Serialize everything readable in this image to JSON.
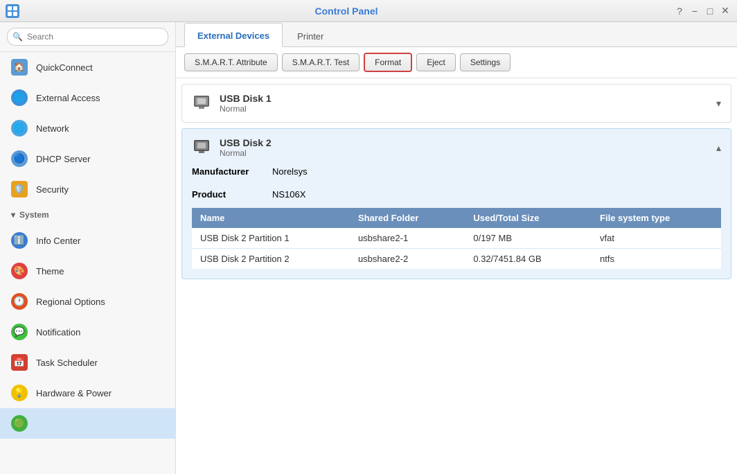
{
  "titlebar": {
    "title": "Control Panel",
    "icon_label": "CP",
    "controls": {
      "question": "?",
      "minimize": "−",
      "maximize": "□",
      "close": "✕"
    }
  },
  "sidebar": {
    "search_placeholder": "Search",
    "items": [
      {
        "id": "home",
        "label": "QuickConnect",
        "icon_type": "home"
      },
      {
        "id": "external-access",
        "label": "External Access",
        "icon_type": "external-access"
      },
      {
        "id": "network",
        "label": "Network",
        "icon_type": "network"
      },
      {
        "id": "dhcp",
        "label": "DHCP Server",
        "icon_type": "dhcp"
      },
      {
        "id": "security",
        "label": "Security",
        "icon_type": "security"
      },
      {
        "id": "system-header",
        "label": "System",
        "is_header": true
      },
      {
        "id": "infocenter",
        "label": "Info Center",
        "icon_type": "infocenter"
      },
      {
        "id": "theme",
        "label": "Theme",
        "icon_type": "theme"
      },
      {
        "id": "regional",
        "label": "Regional Options",
        "icon_type": "regional"
      },
      {
        "id": "notification",
        "label": "Notification",
        "icon_type": "notification"
      },
      {
        "id": "taskscheduler",
        "label": "Task Scheduler",
        "icon_type": "taskscheduler"
      },
      {
        "id": "hwpower",
        "label": "Hardware & Power",
        "icon_type": "hwpower"
      },
      {
        "id": "green",
        "label": "",
        "icon_type": "green"
      }
    ]
  },
  "tabs": [
    {
      "id": "external-devices",
      "label": "External Devices",
      "active": true
    },
    {
      "id": "printer",
      "label": "Printer",
      "active": false
    }
  ],
  "toolbar": {
    "buttons": [
      {
        "id": "smart-attribute",
        "label": "S.M.A.R.T. Attribute",
        "highlighted": false
      },
      {
        "id": "smart-test",
        "label": "S.M.A.R.T. Test",
        "highlighted": false
      },
      {
        "id": "format",
        "label": "Format",
        "highlighted": true
      },
      {
        "id": "eject",
        "label": "Eject",
        "highlighted": false
      },
      {
        "id": "settings",
        "label": "Settings",
        "highlighted": false
      }
    ]
  },
  "disks": [
    {
      "id": "usb-disk-1",
      "name": "USB Disk 1",
      "status": "Normal",
      "expanded": false
    },
    {
      "id": "usb-disk-2",
      "name": "USB Disk 2",
      "status": "Normal",
      "expanded": true,
      "manufacturer_label": "Manufacturer",
      "manufacturer_value": "Norelsys",
      "product_label": "Product",
      "product_value": "NS106X",
      "table": {
        "headers": [
          "Name",
          "Shared Folder",
          "Used/Total Size",
          "File system type"
        ],
        "rows": [
          {
            "name": "USB Disk 2 Partition 1",
            "shared_folder": "usbshare2-1",
            "size": "0/197 MB",
            "fs_type": "vfat"
          },
          {
            "name": "USB Disk 2 Partition 2",
            "shared_folder": "usbshare2-2",
            "size": "0.32/7451.84 GB",
            "fs_type": "ntfs"
          }
        ]
      }
    }
  ]
}
